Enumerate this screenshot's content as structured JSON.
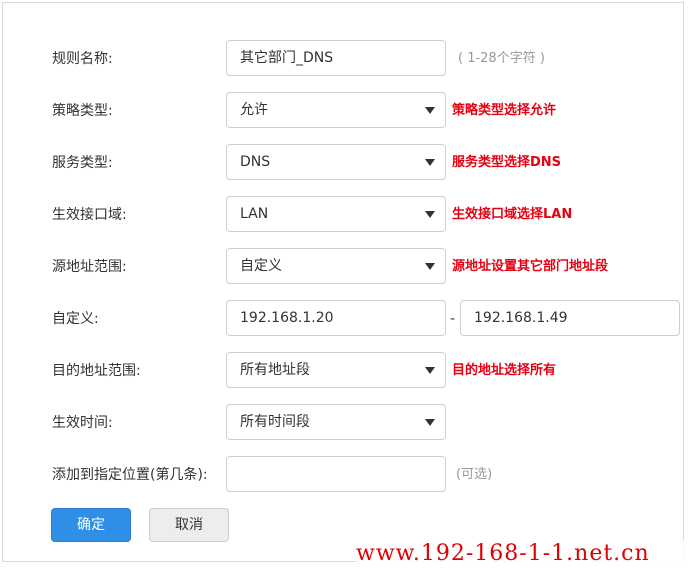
{
  "form": {
    "rule_name": {
      "label": "规则名称:",
      "value": "其它部门_DNS",
      "hint": "( 1-28个字符 )"
    },
    "policy_type": {
      "label": "策略类型:",
      "value": "允许",
      "annotation": "策略类型选择允许"
    },
    "service_type": {
      "label": "服务类型:",
      "value": "DNS",
      "annotation": "服务类型选择DNS"
    },
    "zone": {
      "label": "生效接口域:",
      "value": "LAN",
      "annotation": "生效接口域选择LAN"
    },
    "src_range": {
      "label": "源地址范围:",
      "value": "自定义",
      "annotation": "源地址设置其它部门地址段"
    },
    "custom": {
      "label": "自定义:",
      "start": "192.168.1.20",
      "separator": "-",
      "end": "192.168.1.49"
    },
    "dst_range": {
      "label": "目的地址范围:",
      "value": "所有地址段",
      "annotation": "目的地址选择所有"
    },
    "time": {
      "label": "生效时间:",
      "value": "所有时间段"
    },
    "position": {
      "label": "添加到指定位置(第几条):",
      "value": "",
      "hint": "(可选)"
    }
  },
  "buttons": {
    "ok": "确定",
    "cancel": "取消"
  },
  "watermark": "www.192-168-1-1.net.cn",
  "colors": {
    "accent": "#2f8fe6",
    "annotation": "#e60012"
  }
}
